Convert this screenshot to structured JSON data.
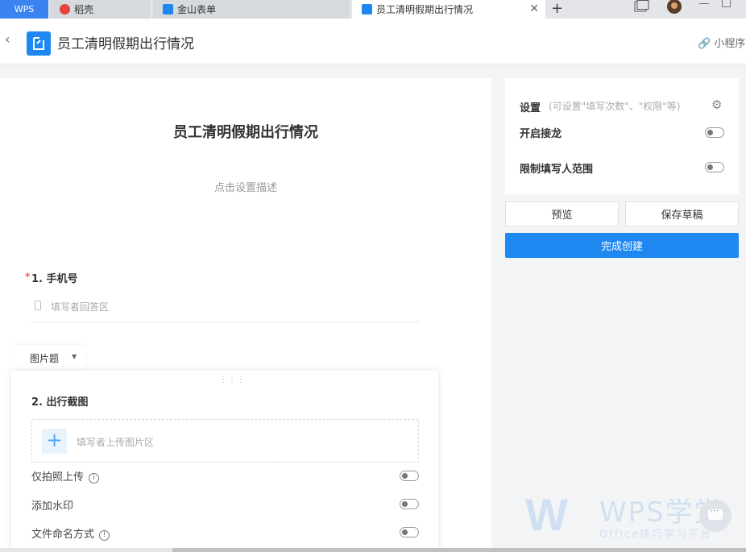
{
  "tabs": {
    "wps": "WPS",
    "daoke": "稻壳",
    "jinshan": "金山表单",
    "active": "员工清明假期出行情况",
    "close": "✕",
    "plus": "+"
  },
  "header": {
    "back": "‹",
    "title": "员工清明假期出行情况",
    "mini_program": "小程序"
  },
  "form": {
    "title": "员工清明假期出行情况",
    "description": "点击设置描述",
    "q1": {
      "required": "*",
      "label": "1.  手机号",
      "placeholder": "填写者回答区"
    },
    "question_type": "图片题",
    "drag": "⋮⋮⋮",
    "q2": {
      "label": "2.  出行截图",
      "upload_placeholder": "填写者上传图片区",
      "plus": "+"
    },
    "options": [
      {
        "label": "仅拍照上传",
        "info": "i",
        "on": false
      },
      {
        "label": "添加水印",
        "on": false
      },
      {
        "label": "文件命名方式",
        "info": "!",
        "on": false
      }
    ]
  },
  "settings": {
    "label": "设置",
    "hint": "(可设置\"填写次数\"、\"权限\"等)",
    "relay": "开启接龙",
    "restrict": "限制填写人范围",
    "relay_on": false,
    "restrict_on": false
  },
  "buttons": {
    "preview": "预览",
    "draft": "保存草稿",
    "create": "完成创建"
  },
  "watermark": {
    "brand": "WPS学堂",
    "sub": "Office技巧学习平台"
  },
  "colors": {
    "accent": "#1e88f0",
    "required": "#f5222d"
  }
}
